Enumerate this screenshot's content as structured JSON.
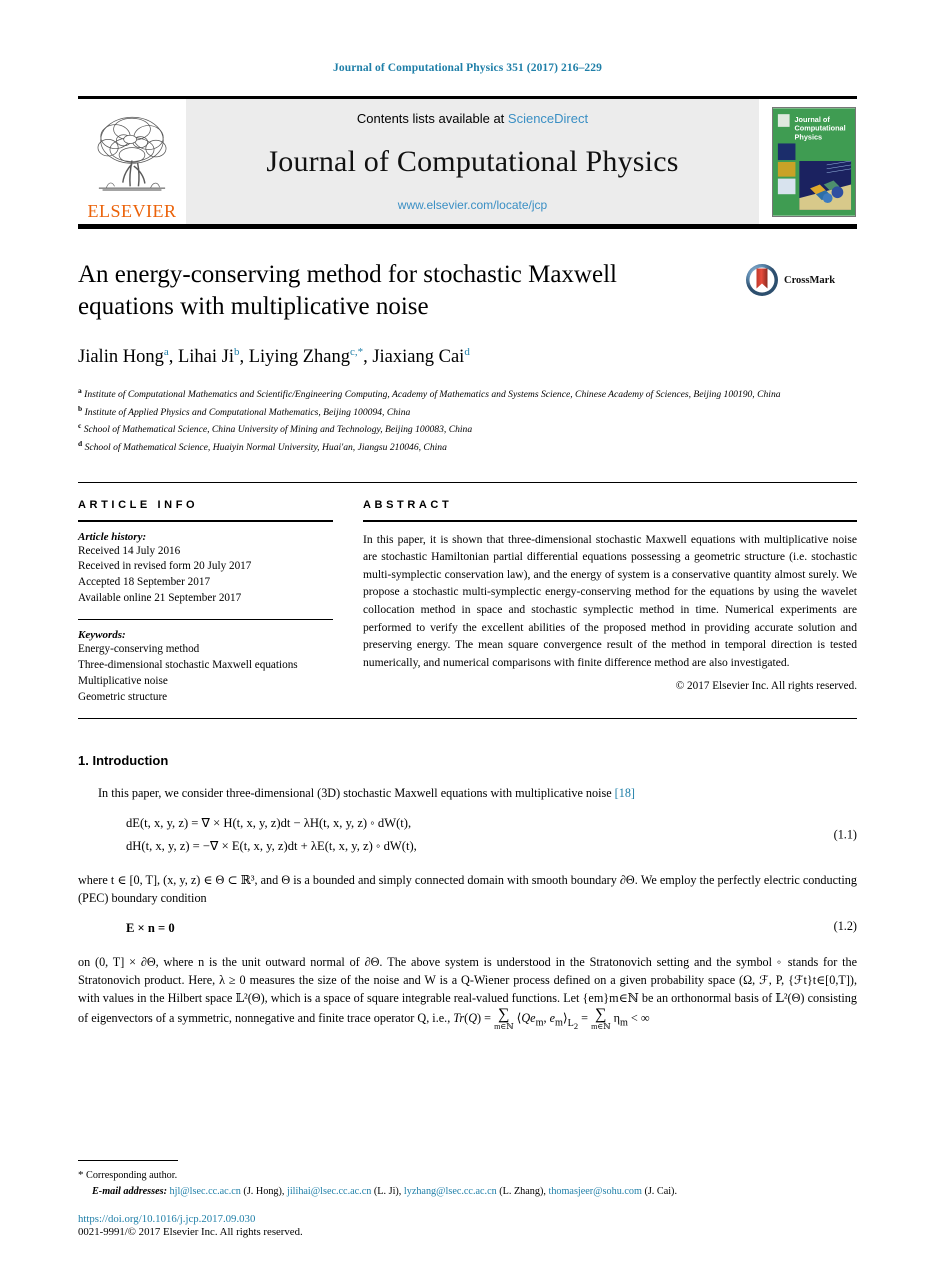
{
  "running_head": "Journal of Computational Physics 351 (2017) 216–229",
  "masthead": {
    "publisher_name": "ELSEVIER",
    "contents_prefix": "Contents lists available at ",
    "contents_link": "ScienceDirect",
    "journal_title": "Journal of Computational Physics",
    "journal_url": "www.elsevier.com/locate/jcp",
    "cover_lines": [
      "Journal of",
      "Computational",
      "Physics"
    ]
  },
  "article": {
    "title": "An energy-conserving method for stochastic Maxwell equations with multiplicative noise",
    "crossmark_label": "CrossMark",
    "authors": [
      {
        "name": "Jialin Hong",
        "sup": "a",
        "sep": ", "
      },
      {
        "name": "Lihai Ji",
        "sup": "b",
        "sep": ", "
      },
      {
        "name": "Liying Zhang",
        "sup": "c,*",
        "sep": ", "
      },
      {
        "name": "Jiaxiang Cai",
        "sup": "d",
        "sep": ""
      }
    ],
    "affiliations": [
      {
        "marker": "a",
        "text": "Institute of Computational Mathematics and Scientific/Engineering Computing, Academy of Mathematics and Systems Science, Chinese Academy of Sciences, Beijing 100190, China"
      },
      {
        "marker": "b",
        "text": "Institute of Applied Physics and Computational Mathematics, Beijing 100094, China"
      },
      {
        "marker": "c",
        "text": "School of Mathematical Science, China University of Mining and Technology, Beijing 100083, China"
      },
      {
        "marker": "d",
        "text": "School of Mathematical Science, Huaiyin Normal University, Huai'an, Jiangsu 210046, China"
      }
    ]
  },
  "info": {
    "heading": "ARTICLE INFO",
    "history_label": "Article history:",
    "history": [
      "Received 14 July 2016",
      "Received in revised form 20 July 2017",
      "Accepted 18 September 2017",
      "Available online 21 September 2017"
    ],
    "keywords_label": "Keywords:",
    "keywords": [
      "Energy-conserving method",
      "Three-dimensional stochastic Maxwell equations",
      "Multiplicative noise",
      "Geometric structure"
    ]
  },
  "abstract": {
    "heading": "ABSTRACT",
    "text": "In this paper, it is shown that three-dimensional stochastic Maxwell equations with multiplicative noise are stochastic Hamiltonian partial differential equations possessing a geometric structure (i.e. stochastic multi-symplectic conservation law), and the energy of system is a conservative quantity almost surely. We propose a stochastic multi-symplectic energy-conserving method for the equations by using the wavelet collocation method in space and stochastic symplectic method in time. Numerical experiments are performed to verify the excellent abilities of the proposed method in providing accurate solution and preserving energy. The mean square convergence result of the method in temporal direction is tested numerically, and numerical comparisons with finite difference method are also investigated.",
    "copyright": "© 2017 Elsevier Inc. All rights reserved."
  },
  "introduction": {
    "section_number": "1.",
    "section_title": "Introduction",
    "para1_pre": "In this paper, we consider three-dimensional (3D) stochastic Maxwell equations with multiplicative noise ",
    "para1_ref": "[18]",
    "eq1_line1": "dE(t, x, y, z) = ∇ × H(t, x, y, z)dt − λH(t, x, y, z) ◦ dW(t),",
    "eq1_line2": "dH(t, x, y, z) = −∇ × E(t, x, y, z)dt + λE(t, x, y, z) ◦ dW(t),",
    "eq1_num": "(1.1)",
    "para2": "where t ∈ [0, T], (x, y, z) ∈ Θ ⊂ ℝ³, and Θ is a bounded and simply connected domain with smooth boundary ∂Θ. We employ the perfectly electric conducting (PEC) boundary condition",
    "eq2": "E × n = 0",
    "eq2_num": "(1.2)",
    "para3_a": "on (0, T] × ∂Θ, where n is the unit outward normal of ∂Θ. The above system is understood in the Stratonovich setting and the symbol ◦ stands for the Stratonovich product. Here, λ ≥ 0 measures the size of the noise and W is a Q-Wiener process defined on a given probability space (Ω, ℱ, P, {ℱt}t∈[0,T]), with values in the Hilbert space 𝕃²(Θ), which is a space of square integrable real-valued functions. Let {em}m∈ℕ be an orthonormal basis of 𝕃²(Θ) consisting of eigenvectors of a symmetric, nonnegative and finite trace operator Q, i.e., ",
    "para3_math": "Tr(Q) = ∑ ⟨Qem, em⟩L₂ = ∑ ηm < ∞",
    "para3_sub": "m∈ℕ"
  },
  "footnotes": {
    "corresponding_marker": "*",
    "corresponding_text": "Corresponding author.",
    "email_label": "E-mail addresses:",
    "emails": [
      {
        "address": "hjl@lsec.cc.ac.cn",
        "owner": "(J. Hong),"
      },
      {
        "address": "jilihai@lsec.cc.ac.cn",
        "owner": "(L. Ji),"
      },
      {
        "address": "lyzhang@lsec.cc.ac.cn",
        "owner": "(L. Zhang),"
      },
      {
        "address": "thomasjeer@sohu.com",
        "owner": "(J. Cai)."
      }
    ],
    "doi": "https://doi.org/10.1016/j.jcp.2017.09.030",
    "issn_line": "0021-9991/© 2017 Elsevier Inc. All rights reserved."
  },
  "colors": {
    "link_blue": "#1f7fa8",
    "sciencedirect_blue": "#3a8fc4",
    "elsevier_orange": "#eb6209",
    "masthead_grey": "#ececec"
  }
}
